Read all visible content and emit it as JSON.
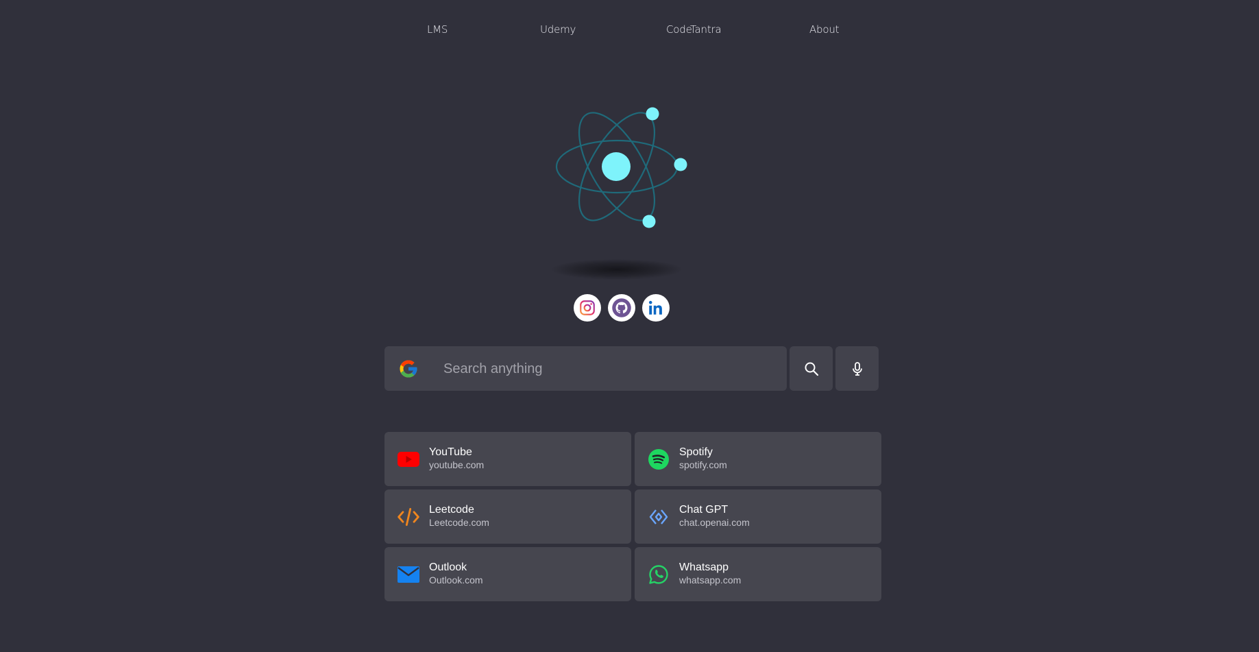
{
  "nav": {
    "items": [
      {
        "label": "LMS"
      },
      {
        "label": "Udemy"
      },
      {
        "label": "CodeTantra"
      },
      {
        "label": "About"
      }
    ]
  },
  "logo": {
    "icon": "atom-icon",
    "color": "#7ef3fb",
    "orbit_color": "#1f6a7a"
  },
  "socials": [
    {
      "name": "Instagram",
      "icon": "instagram-icon",
      "color": "#e1306c"
    },
    {
      "name": "GitHub",
      "icon": "github-icon",
      "color": "#6e5494"
    },
    {
      "name": "LinkedIn",
      "icon": "linkedin-icon",
      "color": "#0a66c2"
    }
  ],
  "search": {
    "placeholder": "Search anything",
    "value": "",
    "engine_icon": "google-icon",
    "search_button_icon": "search-icon",
    "mic_button_icon": "microphone-icon"
  },
  "shortcuts": [
    {
      "name": "YouTube",
      "url": "youtube.com",
      "icon": "youtube-icon",
      "color": "#ff0000"
    },
    {
      "name": "Spotify",
      "url": "spotify.com",
      "icon": "spotify-icon",
      "color": "#1ed760"
    },
    {
      "name": "Leetcode",
      "url": "Leetcode.com",
      "icon": "code-icon",
      "color": "#f0861e"
    },
    {
      "name": "Chat GPT",
      "url": "chat.openai.com",
      "icon": "chatgpt-icon",
      "color": "#6aa6ff"
    },
    {
      "name": "Outlook",
      "url": "Outlook.com",
      "icon": "mail-icon",
      "color": "#1582f0"
    },
    {
      "name": "Whatsapp",
      "url": "whatsapp.com",
      "icon": "whatsapp-icon",
      "color": "#25d366"
    }
  ],
  "colors": {
    "background": "#30303b",
    "panel": "#46464f",
    "search_panel": "#42424c"
  }
}
